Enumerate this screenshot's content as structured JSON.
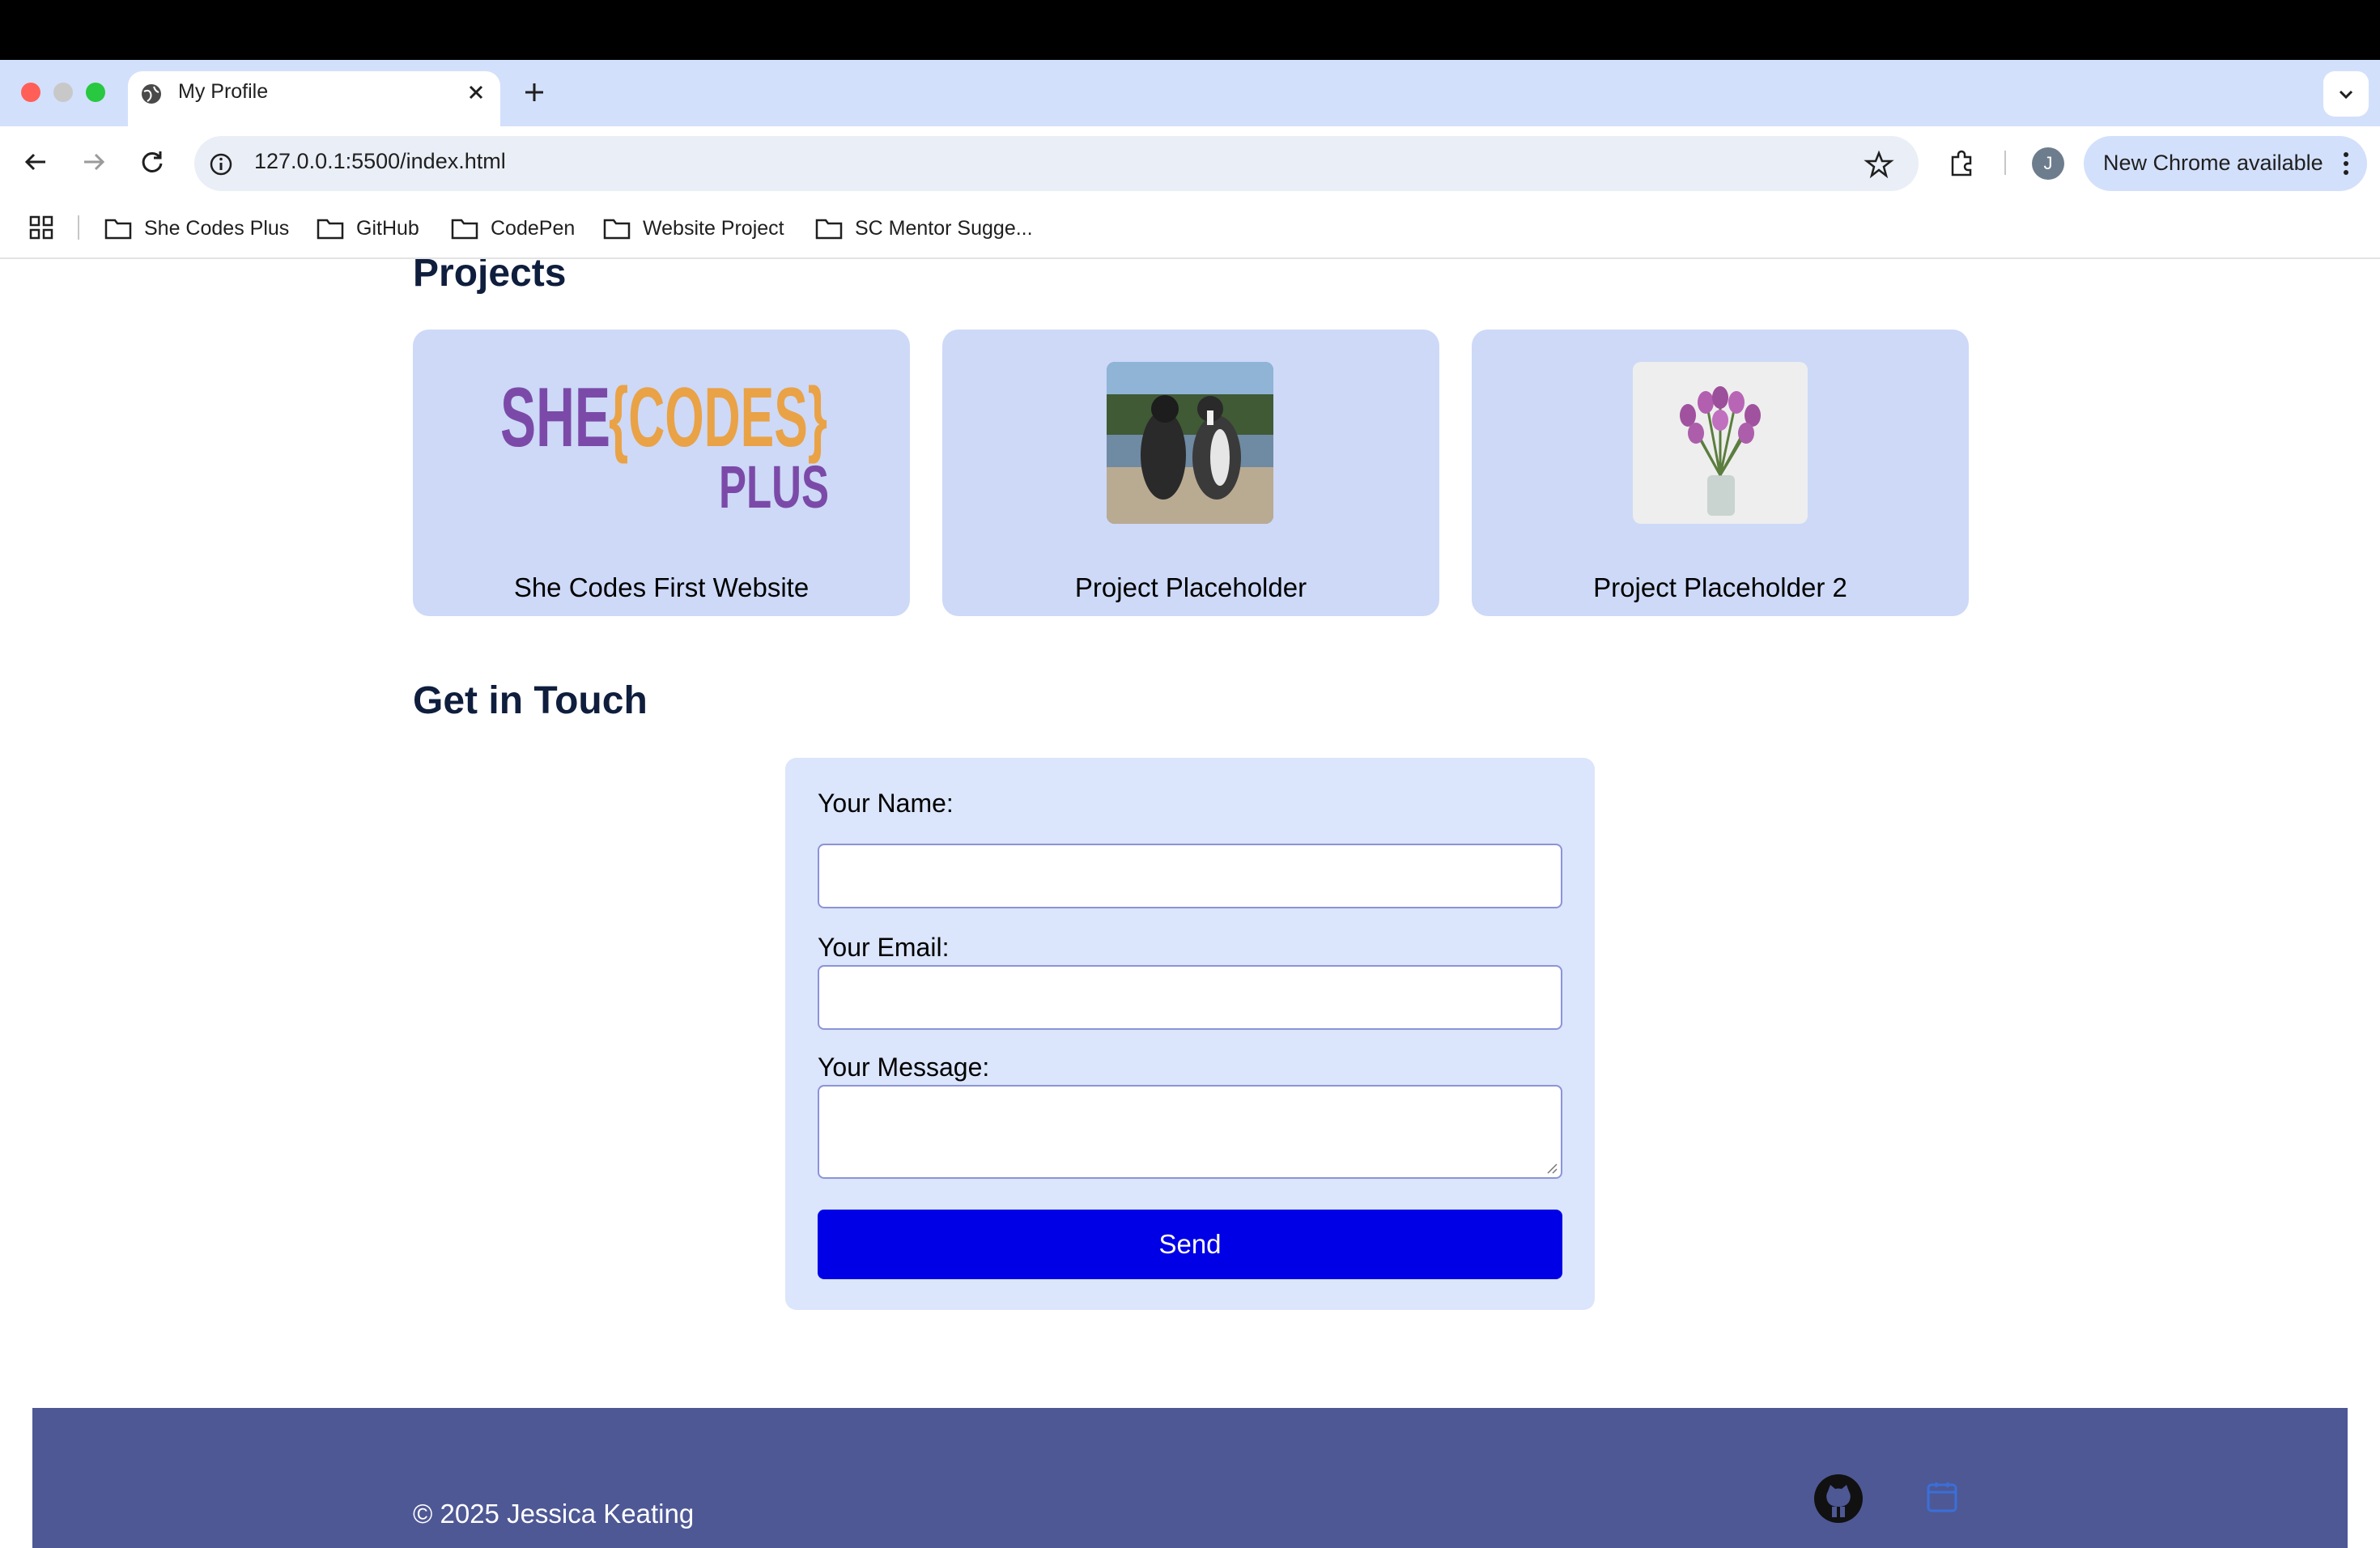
{
  "browser": {
    "tab_title": "My Profile",
    "url": "127.0.0.1:5500/index.html",
    "profile_initial": "J",
    "update_label": "New Chrome available",
    "bookmarks": [
      "She Codes Plus",
      "GitHub",
      "CodePen",
      "Website Project",
      "SC Mentor Sugge..."
    ]
  },
  "projects": {
    "title": "Projects",
    "cards": [
      {
        "label": "She Codes First Website",
        "logo_word_1": "SHE",
        "logo_word_2": "{CODES}",
        "logo_word_3": "PLUS"
      },
      {
        "label": "Project Placeholder"
      },
      {
        "label": "Project Placeholder 2"
      }
    ]
  },
  "contact": {
    "title": "Get in Touch",
    "name_label": "Your Name:",
    "email_label": "Your Email:",
    "message_label": "Your Message:",
    "send_label": "Send"
  },
  "footer": {
    "copyright": "© 2025 Jessica Keating"
  },
  "colors": {
    "card_bg": "#cdd9f7",
    "form_bg": "#dbe5fb",
    "send_bg": "#0000e6",
    "footer_bg": "#4e5895",
    "heading": "#0f1e3d"
  }
}
